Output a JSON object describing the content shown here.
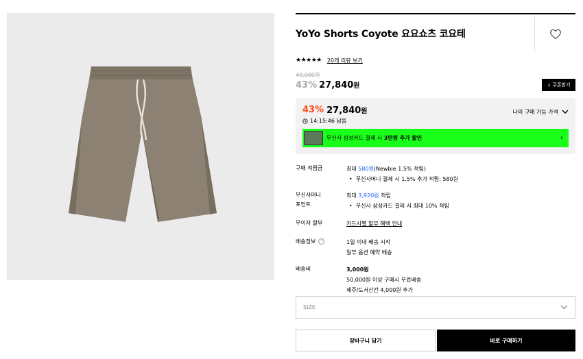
{
  "product": {
    "title": "YoYo Shorts Coyote 요요쇼츠 코요테",
    "image_alt": "shorts-product-image",
    "stars": "★★★★★",
    "review_link": "20개 리뷰 보기",
    "original_price": "49,000원",
    "discount_rate": "43%",
    "price": "27,840",
    "won": "원",
    "coupon_button": "↓ 쿠폰받기"
  },
  "my_price": {
    "discount_rate": "43%",
    "price": "27,840",
    "won": "원",
    "label": "나의 구매 가능 가격",
    "timer": "14:15:46 남음",
    "banner_prefix": "무신사 삼성카드 결제 시 ",
    "banner_bold": "3만원 추가 할인"
  },
  "details": {
    "points_label": "구매 적립금",
    "points_prefix": "최대 ",
    "points_amount": "580원",
    "points_suffix": "(Newbie 1.5% 적립)",
    "points_bullet": "무신사머니 결제 시 1.5% 추가 적립: 580원",
    "money_label_1": "무신사머니",
    "money_label_2": "포인트",
    "money_prefix": "최대 ",
    "money_amount": "3,920원",
    "money_suffix": " 적립",
    "money_bullet": "무신사 삼성카드 결제 시 최대 10% 적립",
    "installment_label": "무이자 할부",
    "installment_link": "카드사별 할부 혜택 안내",
    "shipping_info_label": "배송정보",
    "shipping_info_line1": "1일 이내 배송 시작",
    "shipping_info_line2": "일부 옵션 예약 배송",
    "shipping_fee_label": "배송비",
    "shipping_fee": "3,000원",
    "shipping_free": "50,000원 이상 구매시 무료배송",
    "shipping_island": "제주/도서산간 4,000원 추가"
  },
  "size_select": {
    "placeholder": "SIZE"
  },
  "buttons": {
    "cart": "장바구니 담기",
    "buy": "바로 구매하기"
  },
  "colors": {
    "accent_orange": "#ff4a1a",
    "banner_green": "#1aff1a",
    "link_blue": "#1a5bff",
    "product_shorts": "#8c8172"
  }
}
